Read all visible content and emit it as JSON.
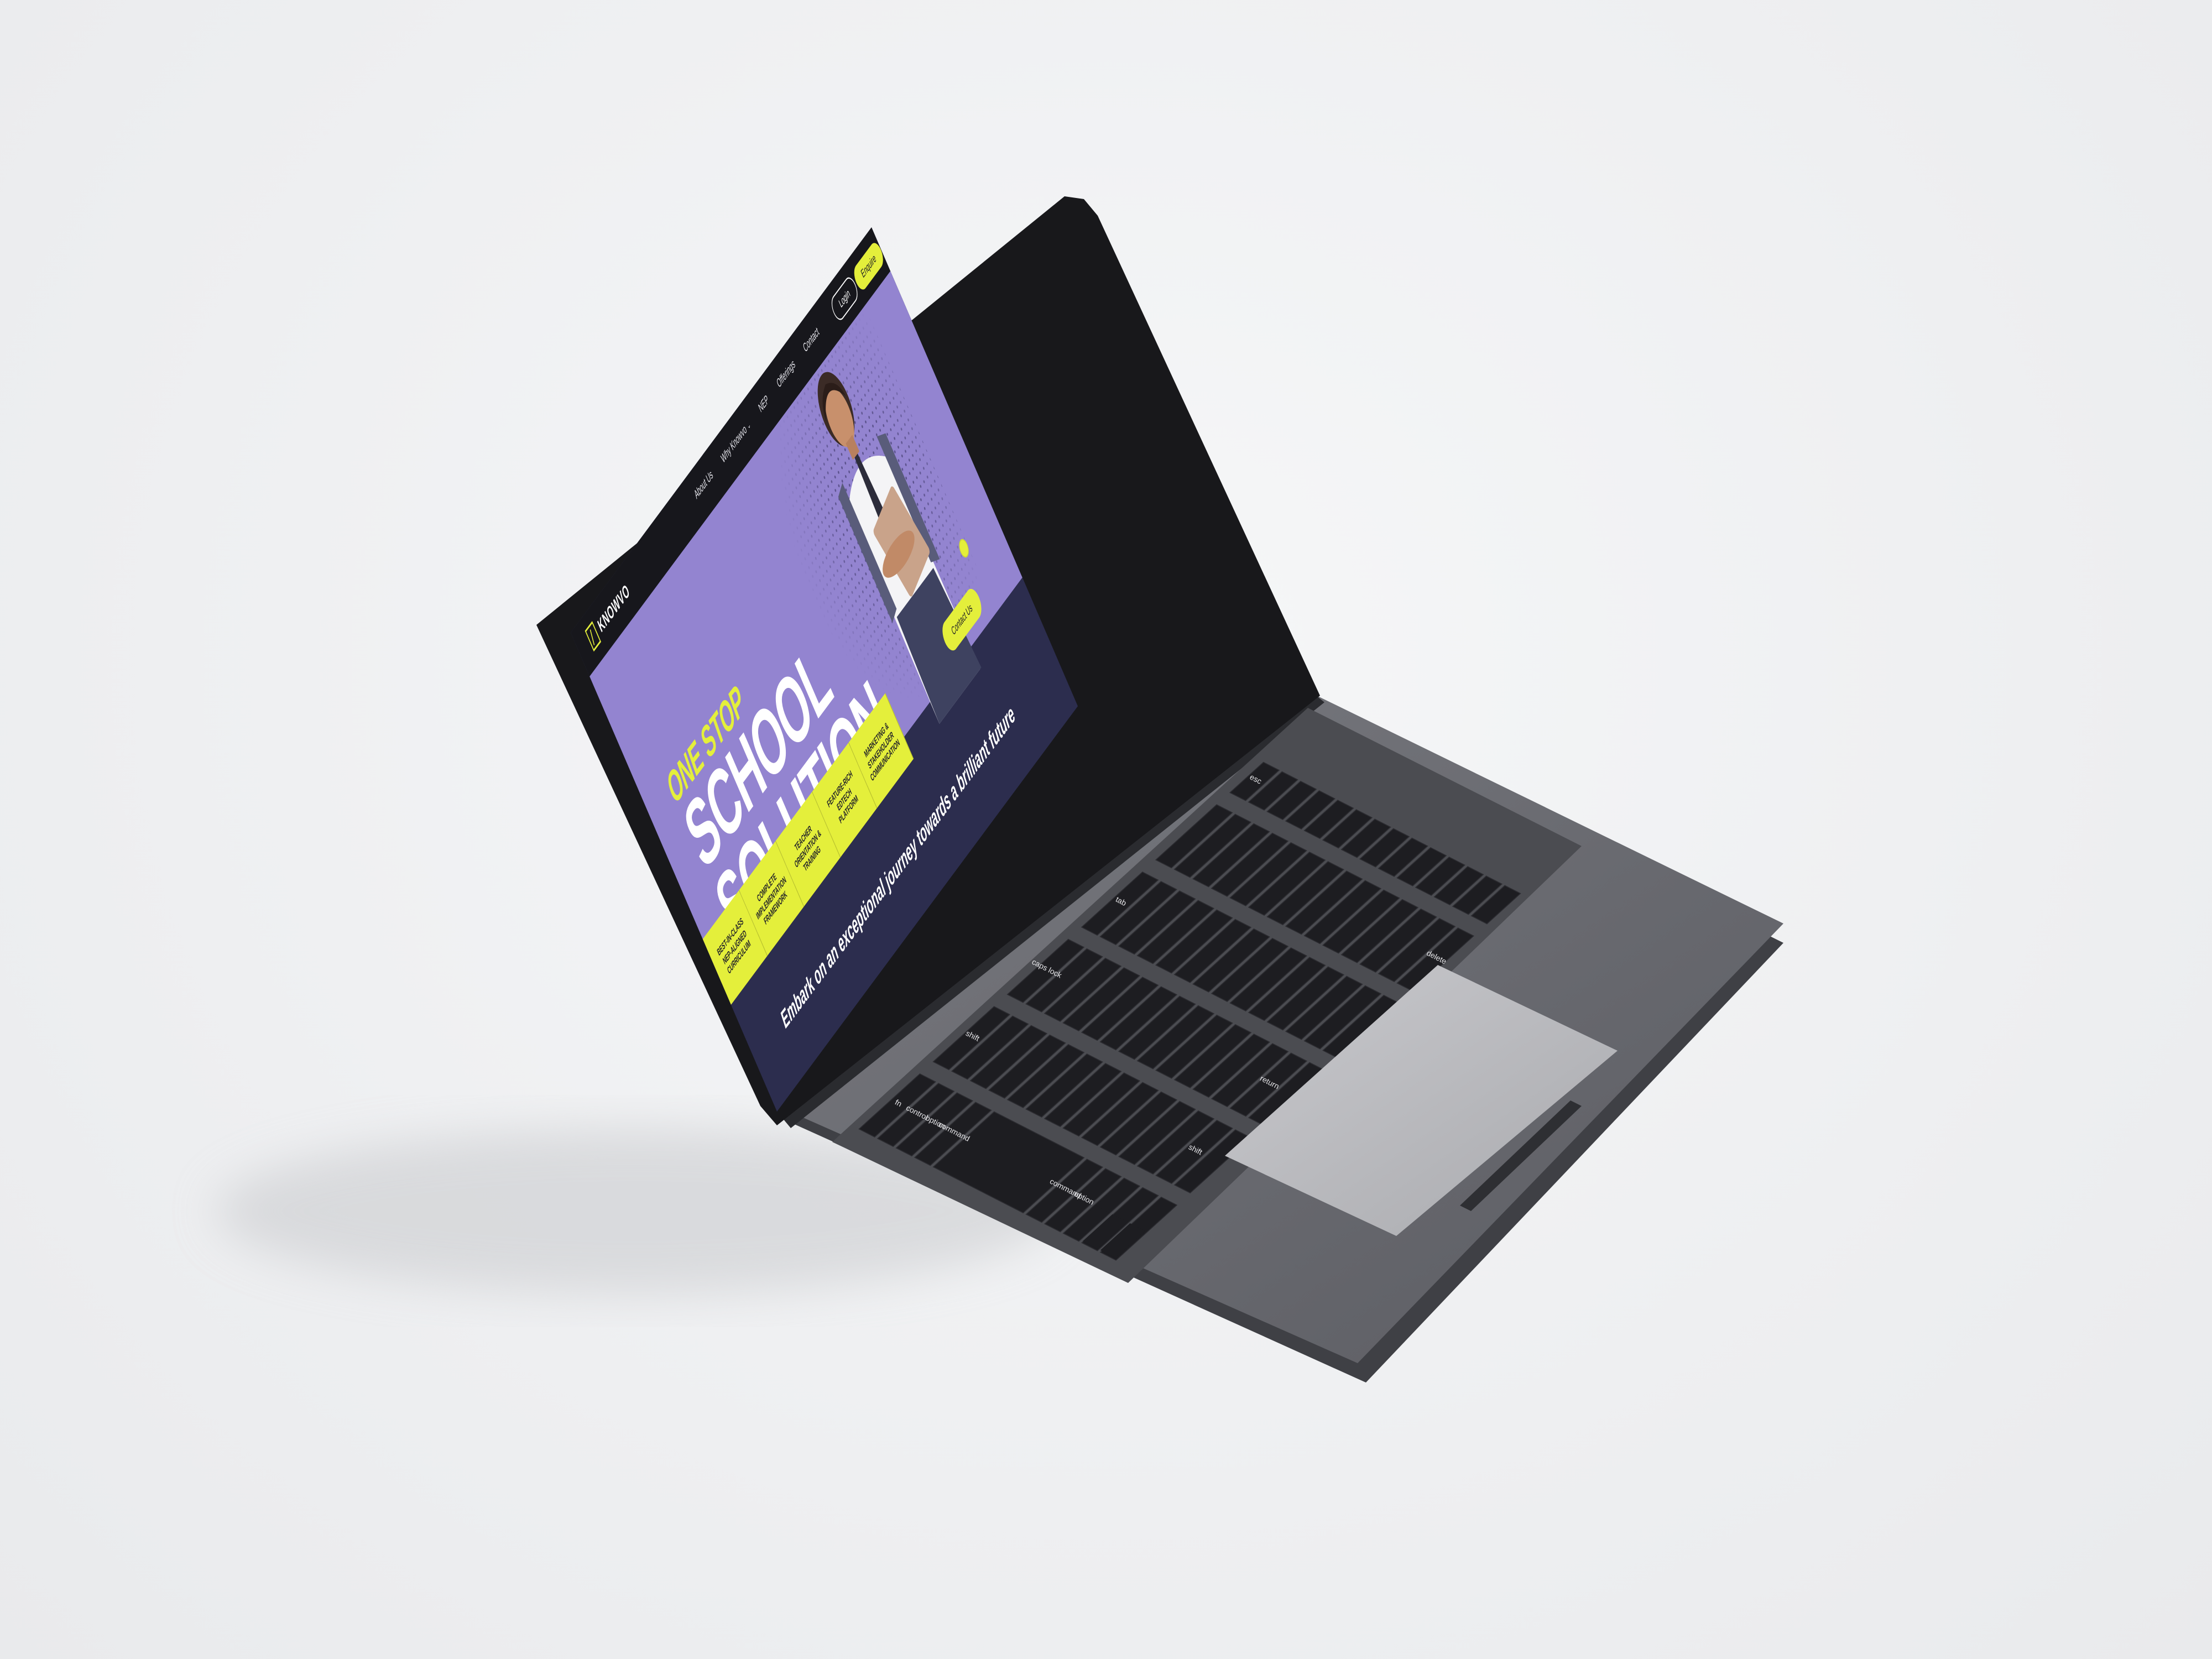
{
  "site": {
    "logo_text": "KNOWVO",
    "nav": [
      {
        "label": "About Us"
      },
      {
        "label": "Why Knowvo"
      },
      {
        "label": "NEP"
      },
      {
        "label": "Offerings"
      },
      {
        "label": "Contact"
      }
    ],
    "login_label": "Login",
    "enquire_label": "Enquire",
    "hero": {
      "line1": "ONE STOP",
      "line2": "SCHOOL",
      "line3": "SOLUTION",
      "contact_label": "Contact Us",
      "tagline": "Embark on an exceptional journey towards a brilliant future"
    },
    "features": [
      "BEST-IN-CLASS NEP-ALIGNED CURRICULUM",
      "COMPLETE IMPLEMENTATION FRAMEWORK",
      "TEACHER ORIENTATION & TRAINING",
      "FEATURE-RICH EDTECH PLATFORM",
      "MARKETING & STAKEHOLDER COMMUNICATION"
    ]
  },
  "keyboard": {
    "labels": {
      "esc": "esc",
      "tab": "tab",
      "caps": "caps lock",
      "shift_l": "shift",
      "fn": "fn",
      "control": "control",
      "option_l": "option",
      "command_l": "command",
      "command_r": "command",
      "option_r": "option",
      "shift_r": "shift",
      "return": "return",
      "delete": "delete"
    }
  },
  "colors": {
    "accent_yellow": "#e4ef3b",
    "hero_purple": "#9384d0",
    "navy": "#2c2d4e",
    "header_black": "#17171c",
    "laptop_body": "#6f7076"
  }
}
